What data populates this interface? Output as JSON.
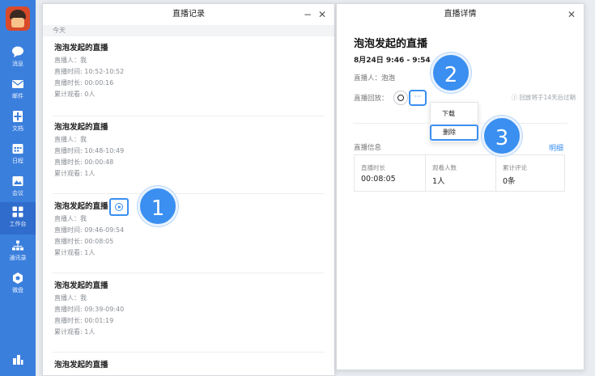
{
  "sidebar": {
    "items": [
      {
        "label": "消息",
        "icon": "chat-bubble-icon"
      },
      {
        "label": "邮件",
        "icon": "mail-icon"
      },
      {
        "label": "文档",
        "icon": "document-icon"
      },
      {
        "label": "日程",
        "icon": "calendar-icon"
      },
      {
        "label": "会议",
        "icon": "meeting-icon"
      },
      {
        "label": "工作台",
        "icon": "workbench-grid-icon"
      },
      {
        "label": "通讯录",
        "icon": "contacts-icon"
      },
      {
        "label": "微盘",
        "icon": "cloud-disk-icon"
      }
    ],
    "active_index": 5
  },
  "records_window": {
    "title": "直播记录",
    "section": "今天",
    "records": [
      {
        "title": "泡泡发起的直播",
        "host": "直播人：我",
        "time": "直播时间: 10:52-10:52",
        "duration": "直播时长: 00:00:16",
        "viewers": "累计观看: 0人"
      },
      {
        "title": "泡泡发起的直播",
        "host": "直播人：我",
        "time": "直播时间: 10:48-10:49",
        "duration": "直播时长: 00:00:48",
        "viewers": "累计观看: 1人"
      },
      {
        "title": "泡泡发起的直播",
        "host": "直播人：我",
        "time": "直播时间: 09:46-09:54",
        "duration": "直播时长: 00:08:05",
        "viewers": "累计观看: 1人"
      },
      {
        "title": "泡泡发起的直播",
        "host": "直播人：我",
        "time": "直播时间: 09:39-09:40",
        "duration": "直播时长: 00:01:19",
        "viewers": "累计观看: 1人"
      },
      {
        "title": "泡泡发起的直播"
      }
    ]
  },
  "detail_window": {
    "title": "直播详情",
    "live_title": "泡泡发起的直播",
    "date": "8月24日 9:46 - 9:54",
    "host_label": "直播人：",
    "host_value": "泡泡",
    "replay_label": "直播回放：",
    "more_label": "···",
    "expire_note": "ⓘ 回放将于14天后过期",
    "menu": {
      "download": "下载",
      "delete": "删除"
    },
    "info_label": "直播信息",
    "detail_link": "明细",
    "stats": [
      {
        "label": "直播时长",
        "value": "00:08:05"
      },
      {
        "label": "观看人数",
        "value": "1人"
      },
      {
        "label": "累计评论",
        "value": "0条"
      }
    ]
  },
  "window_controls": {
    "minimize": "−",
    "close": "✕"
  },
  "callouts": [
    "1",
    "2",
    "3"
  ],
  "colors": {
    "sidebar": "#3b7fdd",
    "accent": "#3a8ff0"
  }
}
